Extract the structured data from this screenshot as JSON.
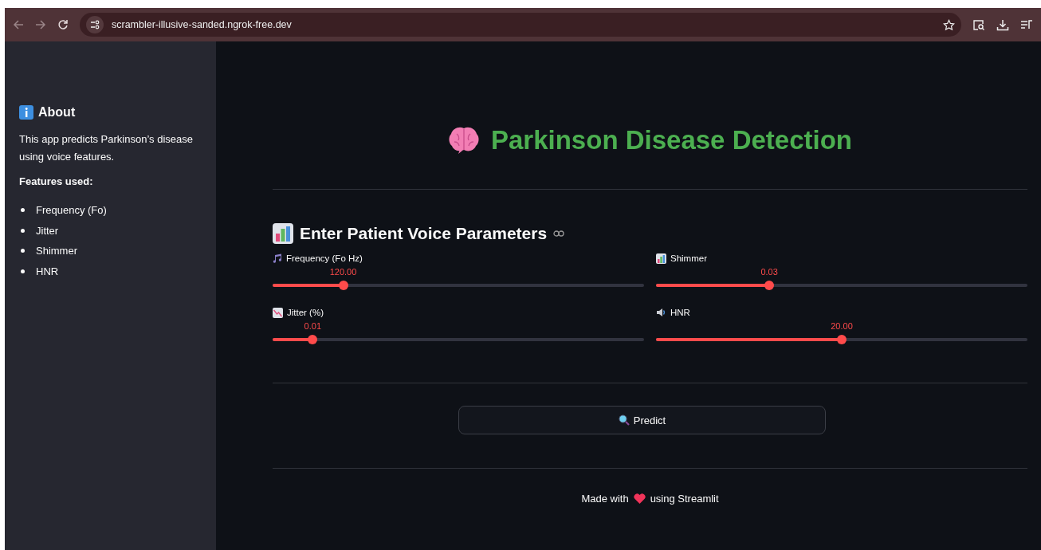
{
  "browser": {
    "url": "scrambler-illusive-sanded.ngrok-free.dev"
  },
  "sidebar": {
    "title": "About",
    "text": "This app predicts Parkinson’s disease using voice features.",
    "subtitle": "Features used:",
    "items": [
      "Frequency (Fo)",
      "Jitter",
      "Shimmer",
      "HNR"
    ]
  },
  "main": {
    "title": "Parkinson Disease Detection",
    "section_title": "Enter Patient Voice Parameters",
    "sliders": [
      {
        "label": "Frequency (Fo Hz)",
        "value": "120.00",
        "level": 0.19
      },
      {
        "label": "Shimmer",
        "value": "0.03",
        "level": 0.305
      },
      {
        "label": "Jitter (%)",
        "value": "0.01",
        "level": 0.108
      },
      {
        "label": "HNR",
        "value": "20.00",
        "level": 0.5
      }
    ],
    "button": "Predict",
    "footer": {
      "before": "Made with",
      "after": "using Streamlit"
    }
  }
}
